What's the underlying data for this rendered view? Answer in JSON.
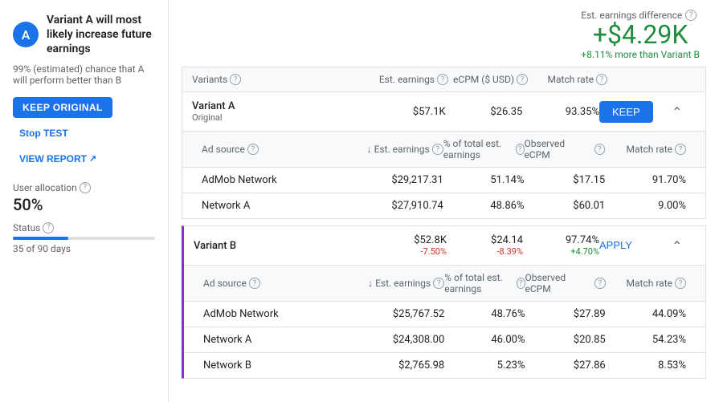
{
  "sidebar": {
    "avatar_letter": "A",
    "main_title": "Variant A will most likely increase future earnings",
    "subtitle": "99% (estimated) chance that A will perform better than B",
    "buttons": {
      "keep_original": "KEEP ORIGINAL",
      "stop_test": "Stop TEST",
      "view_report": "VIEW REPORT"
    },
    "user_allocation_label": "User allocation",
    "user_allocation_value": "50%",
    "status_label": "Status",
    "days_text": "35 of 90 days",
    "status_progress": 39
  },
  "est_difference": {
    "label": "Est. earnings difference",
    "value": "+$4.29K",
    "sub": "+8.11% more than Variant B"
  },
  "table": {
    "headers": {
      "variants": "Variants",
      "est_earnings": "Est. earnings",
      "ecpm": "eCPM ($ USD)",
      "match_rate": "Match rate"
    },
    "variant_a": {
      "name": "Variant A",
      "tag": "Original",
      "est_earnings": "$57.1K",
      "ecpm": "$26.35",
      "match_rate": "93.35%",
      "action": "KEEP"
    },
    "variant_a_sub": {
      "headers": {
        "ad_source": "Ad source",
        "est_earnings": "↓ Est. earnings",
        "pct_total": "% of total est. earnings",
        "observed_ecpm": "Observed eCPM",
        "match_rate": "Match rate"
      },
      "rows": [
        {
          "source": "AdMob Network",
          "est_earnings": "$29,217.31",
          "pct_total": "51.14%",
          "ecpm": "$17.15",
          "match_rate": "91.70%"
        },
        {
          "source": "Network A",
          "est_earnings": "$27,910.74",
          "pct_total": "48.86%",
          "ecpm": "$60.01",
          "match_rate": "9.00%"
        }
      ]
    },
    "variant_b": {
      "name": "Variant B",
      "est_earnings": "$52.8K",
      "est_earnings_delta": "-7.50%",
      "ecpm": "$24.14",
      "ecpm_delta": "-8.39%",
      "match_rate": "97.74%",
      "match_rate_delta": "+4.70%",
      "action": "APPLY"
    },
    "variant_b_sub": {
      "headers": {
        "ad_source": "Ad source",
        "est_earnings": "↓ Est. earnings",
        "pct_total": "% of total est. earnings",
        "observed_ecpm": "Observed eCPM",
        "match_rate": "Match rate"
      },
      "rows": [
        {
          "source": "AdMob Network",
          "est_earnings": "$25,767.52",
          "pct_total": "48.76%",
          "ecpm": "$27.89",
          "match_rate": "44.09%"
        },
        {
          "source": "Network A",
          "est_earnings": "$24,308.00",
          "pct_total": "46.00%",
          "ecpm": "$20.85",
          "match_rate": "54.23%"
        },
        {
          "source": "Network B",
          "est_earnings": "$2,765.98",
          "pct_total": "5.23%",
          "ecpm": "$27.86",
          "match_rate": "8.53%"
        }
      ]
    }
  }
}
